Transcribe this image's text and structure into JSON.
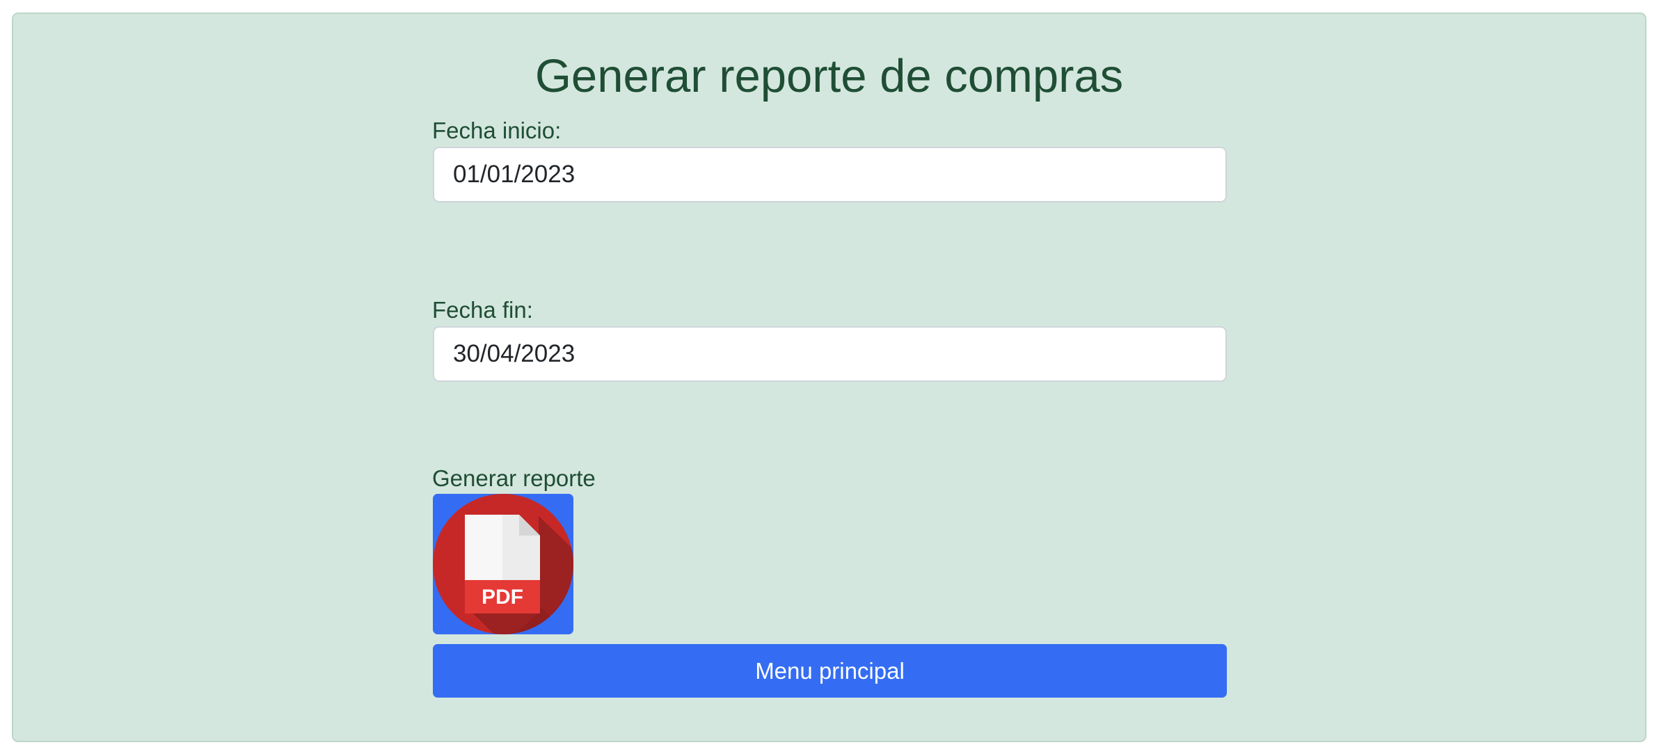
{
  "page": {
    "title": "Generar reporte de compras"
  },
  "form": {
    "start_label": "Fecha inicio:",
    "start_value": "01/01/2023",
    "end_label": "Fecha fin:",
    "end_value": "30/04/2023",
    "report_label": "Generar reporte",
    "pdf_icon": "pdf-file-icon",
    "pdf_text": "PDF",
    "menu_button": "Menu principal"
  },
  "colors": {
    "panel_bg": "#d4e7de",
    "heading": "#1f4e35",
    "primary": "#346df3",
    "pdf_red": "#c62828"
  }
}
